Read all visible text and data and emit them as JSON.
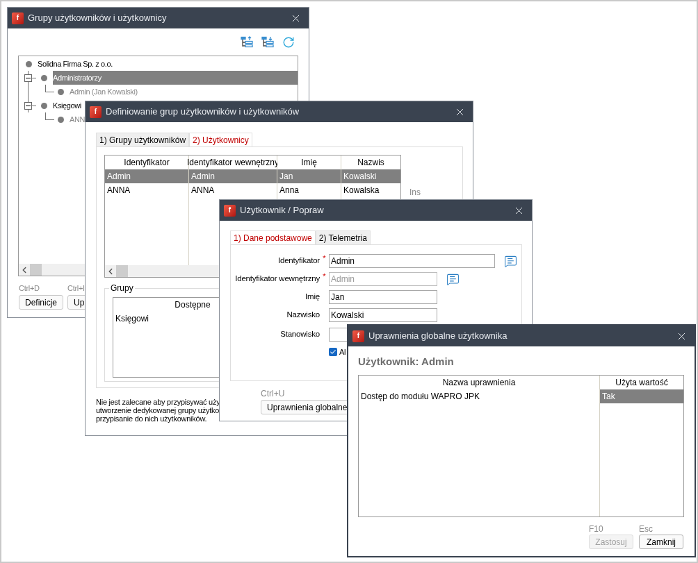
{
  "groups_window": {
    "title": "Grupy użytkowników i użytkownicy",
    "icon_letter": "f",
    "tree": [
      {
        "label": "Solidna Firma Sp. z o.o.",
        "selected": false,
        "inactive": false,
        "children": [
          {
            "label": "Administratorzy",
            "selected": true,
            "inactive": false,
            "expanded": true,
            "children": [
              {
                "label": "Admin (Jan Kowalski)",
                "selected": false,
                "inactive": true
              }
            ]
          },
          {
            "label": "Księgowi",
            "selected": false,
            "inactive": false,
            "expanded": true,
            "children": [
              {
                "label": "ANN",
                "selected": false,
                "inactive": true
              }
            ]
          }
        ]
      }
    ],
    "shortcuts": [
      {
        "key": "Ctrl+D",
        "label": "Definicje"
      },
      {
        "key": "Ctrl+I",
        "label": "Up"
      }
    ]
  },
  "define_window": {
    "title": "Definiowanie grup użytkowników i użytkowników",
    "icon_letter": "f",
    "tabs": [
      {
        "label": "1) Grupy użytkowników",
        "selected": false
      },
      {
        "label": "2) Użytkownicy",
        "selected": true
      }
    ],
    "table": {
      "columns": [
        "Identyfikator",
        "Identyfikator wewnętrzny",
        "Imię",
        "Nazwis"
      ],
      "rows": [
        {
          "cells": [
            "Admin",
            "Admin",
            "Jan",
            "Kowalski"
          ],
          "selected": true
        },
        {
          "cells": [
            "ANNA",
            "ANNA",
            "Anna",
            "Kowalska"
          ],
          "selected": false
        }
      ]
    },
    "side_shortcut": "Ins",
    "groups_box": {
      "title": "Grupy",
      "list_header": "Dostępne",
      "items": [
        "Księgowi"
      ]
    },
    "note_lines": [
      "Nie jest zalecane aby przypisywać uży",
      "utworzenie dedykowanej grupy użytko",
      "przypisanie do nich użytkowników."
    ]
  },
  "user_window": {
    "title": "Użytkownik / Popraw",
    "icon_letter": "f",
    "tabs": [
      {
        "label": "1) Dane podstawowe",
        "selected": true
      },
      {
        "label": "2) Telemetria",
        "selected": false
      }
    ],
    "fields": [
      {
        "label": "Identyfikator",
        "marker": "*",
        "value": "Admin",
        "disabled": false,
        "has_note": true
      },
      {
        "label": "Identyfikator wewnętrzny",
        "marker": "*",
        "value": "Admin",
        "disabled": true,
        "has_note": true
      },
      {
        "label": "Imię",
        "value": "Jan",
        "disabled": false,
        "has_note": false
      },
      {
        "label": "Nazwisko",
        "value": "Kowalski",
        "disabled": false,
        "has_note": false
      },
      {
        "label": "Stanowisko",
        "has_note": false
      }
    ],
    "checkbox": {
      "label": "Al",
      "checked": true
    },
    "button": {
      "key": "Ctrl+U",
      "label": "Uprawnienia globalne"
    }
  },
  "permissions_window": {
    "title": "Uprawnienia globalne użytkownika",
    "icon_letter": "f",
    "heading": "Użytkownik: Admin",
    "table": {
      "columns": [
        "Nazwa uprawnienia",
        "Użyta wartość"
      ],
      "rows": [
        {
          "cells": [
            "Dostęp do modułu WAPRO JPK",
            "Tak"
          ],
          "selected": true
        }
      ]
    },
    "buttons": [
      {
        "key": "F10",
        "label": "Zastosuj",
        "disabled": true
      },
      {
        "key": "Esc",
        "label": "Zamknij",
        "disabled": false
      }
    ]
  }
}
